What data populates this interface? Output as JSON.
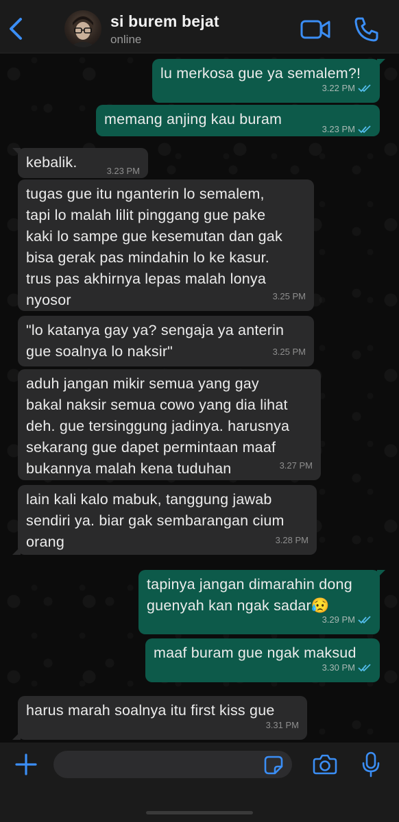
{
  "header": {
    "contact_name": "si burem bejat",
    "status": "online"
  },
  "messages": [
    {
      "dir": "out",
      "text": "lu merkosa gue ya semalem?!",
      "time": "3.22 PM",
      "read": true
    },
    {
      "dir": "out",
      "text": "memang anjing kau buram",
      "time": "3.23 PM",
      "read": true
    },
    {
      "dir": "in",
      "text": "kebalik.",
      "time": "3.23 PM"
    },
    {
      "dir": "in",
      "text": "tugas gue itu nganterin lo semalem,\ntapi lo malah lilit pinggang gue pake\nkaki lo sampe gue kesemutan dan gak\nbisa gerak pas mindahin lo ke kasur.\ntrus pas akhirnya lepas malah lonya\nnyosor",
      "time": "3.25 PM"
    },
    {
      "dir": "in",
      "text": "\"lo katanya gay ya? sengaja ya anterin\ngue soalnya lo naksir\"",
      "time": "3.25 PM"
    },
    {
      "dir": "in",
      "text": "aduh jangan mikir semua yang gay\nbakal naksir semua cowo yang dia lihat\ndeh. gue tersinggung jadinya. harusnya\nsekarang gue dapet permintaan maaf\nbukannya malah kena tuduhan",
      "time": "3.27 PM"
    },
    {
      "dir": "in",
      "text": "lain kali kalo mabuk, tanggung jawab\nsendiri ya. biar gak sembarangan cium\norang",
      "time": "3.28 PM"
    },
    {
      "dir": "out",
      "text": "tapinya jangan dimarahin dong\nguenyah kan ngak sadar😥",
      "time": "3.29 PM",
      "read": true
    },
    {
      "dir": "out",
      "text": "maaf buram gue ngak maksud",
      "time": "3.30 PM",
      "read": true
    },
    {
      "dir": "in",
      "text": "harus marah soalnya itu first kiss gue",
      "time": "3.31 PM"
    }
  ],
  "composer": {
    "value": "",
    "placeholder": ""
  },
  "colors": {
    "outgoing_bubble": "#0d5a4a",
    "incoming_bubble": "#2a2a2b",
    "accent": "#3b8ef5",
    "read_tick": "#53bdeb"
  },
  "icons": [
    "back-chevron-icon",
    "video-call-icon",
    "phone-icon",
    "plus-icon",
    "sticker-icon",
    "camera-icon",
    "mic-icon"
  ]
}
